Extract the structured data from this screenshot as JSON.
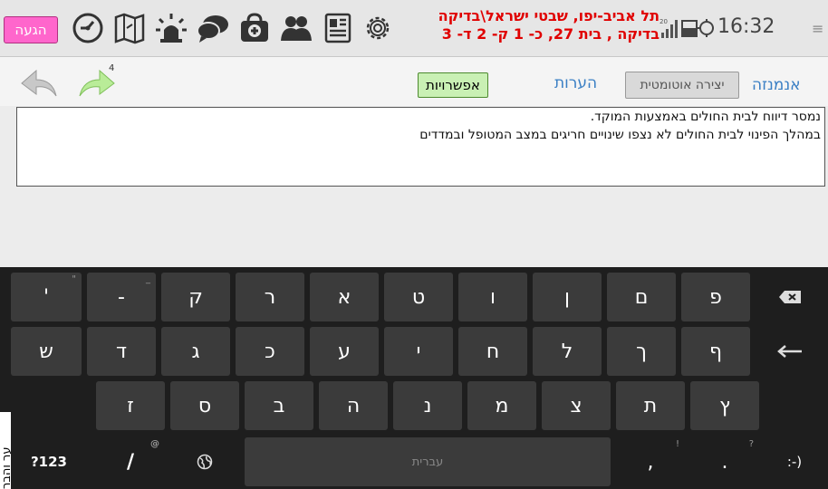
{
  "status_bar": {
    "arrive_label": "הגעה",
    "location_line1": "תל אביב-יפו, שבטי ישראל\\בדיקה",
    "location_line2": "בדיקה , בית 27, כ- 1 ק- 2 ד- 3",
    "signal_badge": "20",
    "time": "16:32",
    "menu_icon": "≡",
    "icons": [
      "speedometer-icon",
      "map-icon",
      "siren-icon",
      "chat-icon",
      "medical-bag-icon",
      "team-icon",
      "document-icon",
      "gear-icon"
    ]
  },
  "toolbar": {
    "forward_badge": "4",
    "options_label": "אפשרויות",
    "notes_tab": "הערות",
    "auto_create_label": "יצירה אוטומטית",
    "anamnesis_tab": "אנמנזה"
  },
  "notes_text": {
    "line1": "נמסר דיווח לבית החולים באמצעות המוקד.",
    "line2": "במהלך הפינוי לבית החולים לא נצפו שינויים חריגים במצב המטופל ובמדדים"
  },
  "keyboard": {
    "row1": [
      "'",
      "-",
      "ק",
      "ר",
      "א",
      "ט",
      "ו",
      "ן",
      "ם",
      "פ"
    ],
    "row1_hints": [
      "\"",
      "_"
    ],
    "row2": [
      "ש",
      "ד",
      "ג",
      "כ",
      "ע",
      "י",
      "ח",
      "ל",
      "ך",
      "ף"
    ],
    "row3": [
      "ז",
      "ס",
      "ב",
      "ה",
      "נ",
      "מ",
      "צ",
      "ת",
      "ץ"
    ],
    "row4": {
      "numbers": "?123",
      "slash": "/",
      "slash_hint": "@",
      "space": "עברית",
      "comma": ",",
      "comma_hint": "!",
      "period": ".",
      "period_hint": "?",
      "smiley": ":-)"
    }
  },
  "side_label": "ער והבר"
}
